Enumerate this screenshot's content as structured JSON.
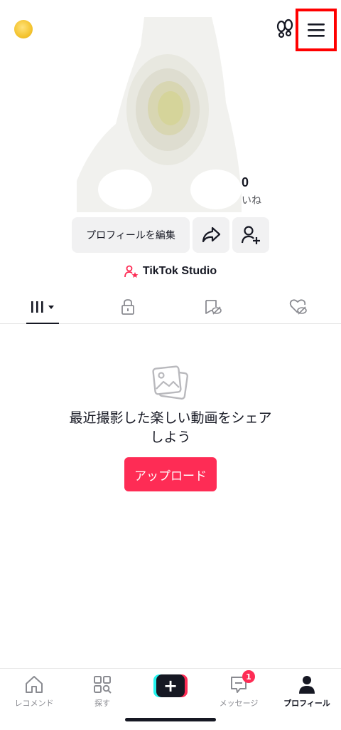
{
  "profile": {
    "stat_likes_value": "0",
    "stat_likes_label": "いね",
    "edit_button_label": "プロフィールを編集",
    "studio_label": "TikTok Studio"
  },
  "empty_state": {
    "message_line1": "最近撮影した楽しい動画をシェア",
    "message_line2": "しよう",
    "upload_label": "アップロード"
  },
  "tabs": [
    {
      "name": "videos",
      "icon": "grid-icon"
    },
    {
      "name": "private",
      "icon": "lock-icon"
    },
    {
      "name": "reposts",
      "icon": "hidden-repost-icon"
    },
    {
      "name": "liked",
      "icon": "hidden-heart-icon"
    }
  ],
  "bottom_nav": {
    "home_label": "レコメンド",
    "discover_label": "探す",
    "inbox_label": "メッセージ",
    "inbox_badge": "1",
    "profile_label": "プロフィール"
  },
  "colors": {
    "accent": "#fe2c55",
    "highlight_box": "#ff0000",
    "text_primary": "#161823"
  }
}
